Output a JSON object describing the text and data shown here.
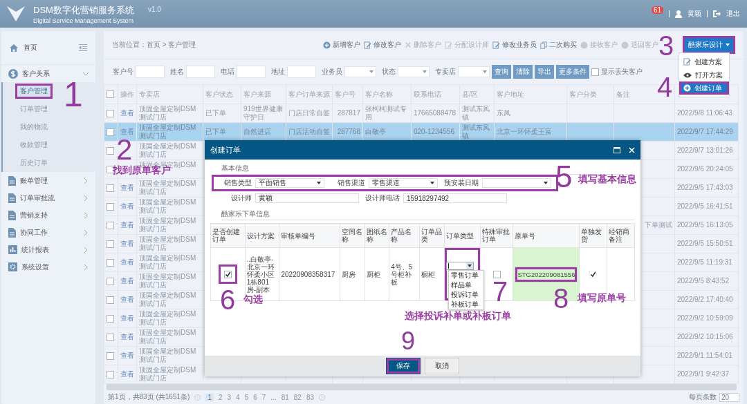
{
  "header": {
    "title": "DSM数字化营销服务系统",
    "version": "v1.0",
    "subtitle": "Digital Service Management System",
    "badge": "61",
    "user": "黄颖",
    "logout": "退出"
  },
  "sidebar": {
    "home": "首页",
    "items": [
      {
        "label": "客户关系",
        "kind": "dollar",
        "expanded": true,
        "children": [
          {
            "label": "客户管理",
            "selected": true,
            "highlighted": true
          },
          {
            "label": "订单管理",
            "selected": false,
            "highlighted": false
          },
          {
            "label": "我的物流",
            "selected": false,
            "highlighted": false
          },
          {
            "label": "收款管理",
            "selected": false,
            "highlighted": false
          },
          {
            "label": "历史订单",
            "selected": false,
            "highlighted": false
          }
        ]
      },
      {
        "label": "账单管理",
        "kind": "doc",
        "expanded": false
      },
      {
        "label": "订单审批流",
        "kind": "doc",
        "expanded": false
      },
      {
        "label": "营销支持",
        "kind": "doc",
        "expanded": false
      },
      {
        "label": "协同工作",
        "kind": "doc",
        "expanded": false
      },
      {
        "label": "统计报表",
        "kind": "chart",
        "expanded": false
      },
      {
        "label": "系统设置",
        "kind": "gear",
        "expanded": false
      }
    ]
  },
  "breadcrumb": "当前位置：首页 > 客户管理",
  "toolbar": [
    {
      "label": "新增客户",
      "kind": "plus",
      "disabled": false
    },
    {
      "label": "修改客户",
      "kind": "edit",
      "disabled": false
    },
    {
      "label": "删除客户",
      "kind": "cross",
      "disabled": true
    },
    {
      "label": "分配设计师",
      "kind": "edit",
      "disabled": true
    },
    {
      "label": "修改业务员",
      "kind": "edit",
      "disabled": false
    },
    {
      "label": "二次购买",
      "kind": "copy",
      "disabled": false
    },
    {
      "label": "接收客户",
      "kind": "dot",
      "disabled": true
    },
    {
      "label": "退回客户",
      "kind": "dot",
      "disabled": true
    }
  ],
  "design_button": {
    "label": "酷家乐设计",
    "highlighted": true
  },
  "design_menu": [
    {
      "label": "创建方案",
      "kind": "edit",
      "selected": false,
      "highlighted": false
    },
    {
      "label": "打开方案",
      "kind": "eye",
      "selected": false,
      "highlighted": false
    },
    {
      "label": "创建订单",
      "kind": "plus",
      "selected": true,
      "highlighted": true
    }
  ],
  "filters": [
    {
      "label": "客户号",
      "kind": "input"
    },
    {
      "label": "姓名",
      "kind": "input"
    },
    {
      "label": "电话",
      "kind": "input"
    },
    {
      "label": "地址",
      "kind": "input"
    },
    {
      "label": "业务员",
      "kind": "select"
    },
    {
      "label": "状态",
      "kind": "select"
    },
    {
      "label": "专卖店",
      "kind": "select"
    }
  ],
  "filter_buttons": [
    "查询",
    "清除",
    "导出",
    "更多条件"
  ],
  "show_lost": {
    "label": "显示丢失客户",
    "checked": false
  },
  "table": {
    "all_checked": false,
    "columns": [
      "操作",
      "专卖店",
      "客户状态",
      "客户来源",
      "客户订单来源",
      "客户号",
      "客户名称",
      "联系电话",
      "县/区",
      "客户地址",
      "客户分类",
      "备注"
    ],
    "rows": [
      {
        "selected": false,
        "checked": false,
        "action": "查看",
        "store": "顶固全屋定制DSM测试门店",
        "status": "已下单",
        "source": "919世界健康守护日",
        "order_source": "门店日常自签",
        "customer_no": "287817",
        "name": "张柯柯测试专用",
        "phone": "17665088478",
        "district": "测试东凤镇",
        "address": "东凤",
        "created": "2022/9/8 11:06:43"
      },
      {
        "selected": true,
        "checked": false,
        "action": "查看",
        "store": "顶固全屋定制DSM测试门店",
        "status": "已下单",
        "source": "自然进店",
        "order_source": "门店活动自签",
        "customer_no": "287768",
        "name": "白敬亭",
        "phone": "020-1234556",
        "district": "测试东凤镇",
        "address": "北京一环怀柔王富",
        "created": "2022/9/7 17:44:29"
      },
      {
        "selected": false,
        "checked": false,
        "store": "顶固全屋定制DSM测试门店",
        "created": "2022/9/7 13:01:26"
      },
      {
        "selected": false,
        "checked": false,
        "store": "顶固全屋定制DSM",
        "created": "2022/9/6 20:24:05"
      },
      {
        "selected": false,
        "checked": false,
        "action": "查看",
        "store": "顶固全屋定制DSM测试门店",
        "created": "2022/9/5 17:43:03"
      },
      {
        "selected": false,
        "checked": false,
        "action": "查看",
        "store": "顶固全屋定制DSM测试门店",
        "created": "2022/9/5 16:41:51"
      },
      {
        "selected": false,
        "checked": false,
        "action": "查看",
        "store": "顶固全屋定制DSM测试门店",
        "remark": "下单测试",
        "created": "2022/9/5 16:13:05"
      },
      {
        "selected": false,
        "checked": false,
        "action": "查看",
        "store": "顶固全屋定制DSM测试门店",
        "created": "2022/9/5 15:50:51"
      },
      {
        "selected": false,
        "checked": false,
        "action": "查看",
        "store": "顶固全屋定制DSM测试门店",
        "created": "2022/9/5 11:19:31"
      },
      {
        "selected": false,
        "checked": false,
        "action": "查看",
        "store": "顶固全屋定制DSM测试门店",
        "created": "2022/9/5 8:43:52"
      },
      {
        "selected": false,
        "checked": false,
        "action": "查看",
        "store": "顶固全屋定制DSM测试门店",
        "created": "2022/9/2 17:40:40"
      },
      {
        "selected": false,
        "checked": false,
        "action": "查看",
        "store": "顶固全屋定制DSM测试门店",
        "created": "2022/9/2 10:59:09"
      },
      {
        "selected": false,
        "checked": false,
        "action": "查看",
        "store": "顶固全屋定制DSM测试门店",
        "created": "2022/9/2 10:15:06"
      },
      {
        "selected": false,
        "checked": false,
        "action": "查看",
        "store": "顶固全屋定制DSM测试门店",
        "created": "2022/9/1 11:54:01"
      },
      {
        "selected": false,
        "checked": false,
        "action": "查看",
        "store": "顶固全屋定制DSM测试门店",
        "created": "2022/9/1 9:42:37"
      }
    ]
  },
  "pager": {
    "summary": "第1页，共83页 (共1651条)",
    "pages": [
      {
        "label": "1",
        "selected": true
      },
      {
        "label": "2",
        "selected": false
      },
      {
        "label": "3",
        "selected": false
      },
      {
        "label": "4",
        "selected": false
      },
      {
        "label": "5",
        "selected": false
      },
      {
        "label": "6",
        "selected": false
      },
      {
        "label": "7",
        "selected": false
      },
      {
        "label": "...",
        "selected": false
      },
      {
        "label": "81",
        "selected": false
      },
      {
        "label": "82",
        "selected": false
      },
      {
        "label": "83",
        "selected": false
      }
    ],
    "page_size_label": "每页条数",
    "page_size": "20"
  },
  "dialog": {
    "title": "创建订单",
    "basic_section": "基本信息",
    "basic_highlighted": true,
    "fields_row1": [
      {
        "label": "销售类型",
        "value": "平面销售",
        "kind": "select"
      },
      {
        "label": "销售渠道",
        "value": "零售渠道",
        "kind": "select"
      },
      {
        "label": "预安装日期",
        "kind": "select"
      }
    ],
    "fields_row2": [
      {
        "label": "设计师",
        "value": "黄颖",
        "kind": "input"
      },
      {
        "label": "设计师电话",
        "value": "15918297492",
        "kind": "input"
      }
    ],
    "order_section": "酷家乐下单信息",
    "order_columns": [
      "是否创建订单",
      "设计方案",
      "审核单编号",
      "空间名称",
      "图纸名称",
      "产品名称",
      "订单品类",
      "订单类型",
      "特殊审批订单",
      "原单号",
      "单独发货",
      "经销商备注"
    ],
    "order_row": {
      "create": {
        "checked": true,
        "highlighted": true
      },
      "design": "..白敬亭-北京一环怀柔小区1栋801房-副本",
      "audit_no": "20220908358317",
      "space": "厨房",
      "drawing": "厨柜",
      "product": "4号、5号柜补板",
      "category": "橱柜",
      "order_type": {
        "open": true,
        "highlighted": true,
        "options": [
          "零售订单",
          "样品单",
          "投诉订单",
          "补板订单"
        ]
      },
      "special": {
        "checked": false
      },
      "original_no": {
        "value": "STG202209081556",
        "highlighted": true
      },
      "ship_separately": {
        "checked": true
      }
    },
    "buttons": [
      {
        "label": "保存",
        "kind": "primary",
        "highlighted": true
      },
      {
        "label": "取消",
        "kind": "default",
        "highlighted": false
      }
    ]
  },
  "annotations": [
    {
      "kind": "step",
      "text": "1"
    },
    {
      "kind": "step",
      "text": "2"
    },
    {
      "kind": "note",
      "text": "找到原单客户"
    },
    {
      "kind": "step",
      "text": "3"
    },
    {
      "kind": "step",
      "text": "4"
    },
    {
      "kind": "step",
      "text": "5"
    },
    {
      "kind": "note",
      "text": "填写基本信息"
    },
    {
      "kind": "step",
      "text": "6"
    },
    {
      "kind": "note",
      "text": "勾选"
    },
    {
      "kind": "step",
      "text": "7"
    },
    {
      "kind": "note",
      "text": "选择投诉补单或补板订单"
    },
    {
      "kind": "step",
      "text": "8"
    },
    {
      "kind": "note",
      "text": "填写原单号"
    },
    {
      "kind": "step",
      "text": "9"
    }
  ]
}
